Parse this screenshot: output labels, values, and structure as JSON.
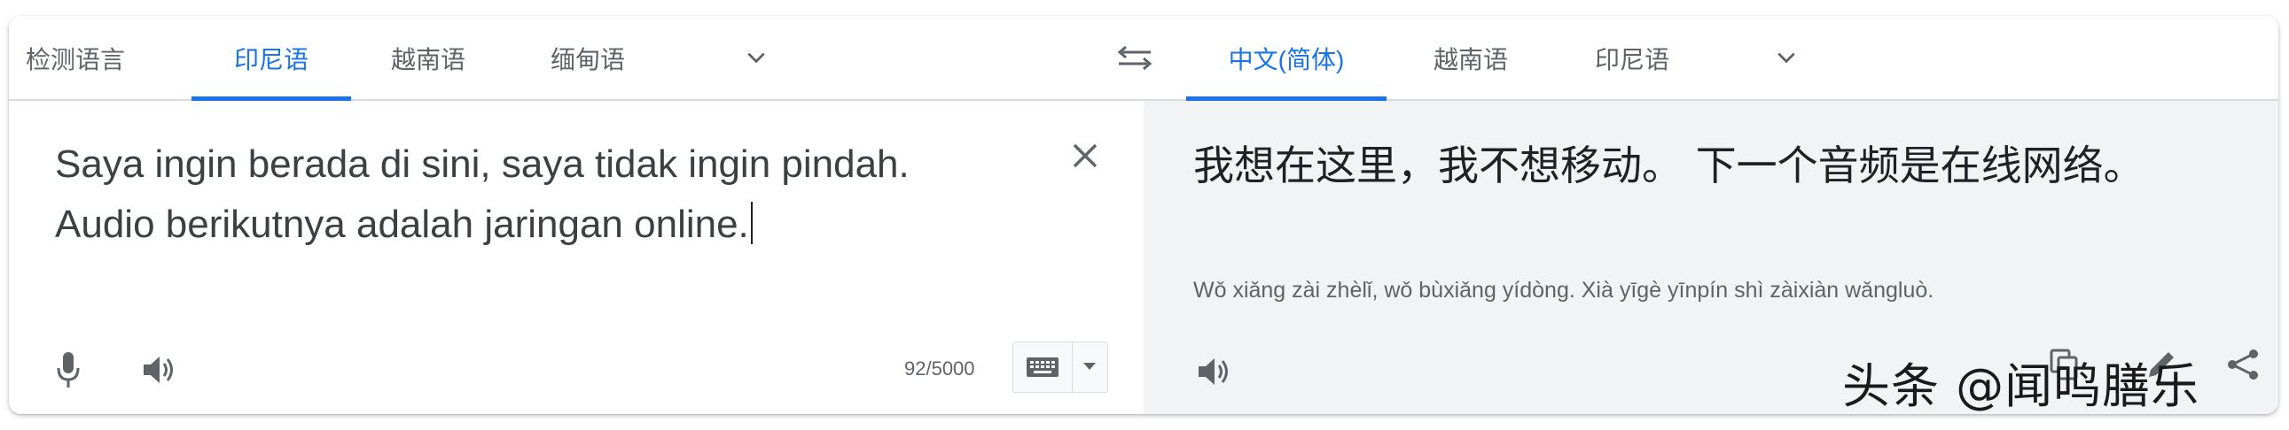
{
  "source_tabs": [
    {
      "label": "检测语言",
      "active": false
    },
    {
      "label": "印尼语",
      "active": true
    },
    {
      "label": "越南语",
      "active": false
    },
    {
      "label": "缅甸语",
      "active": false
    }
  ],
  "target_tabs": [
    {
      "label": "中文(简体)",
      "active": true
    },
    {
      "label": "越南语",
      "active": false
    },
    {
      "label": "印尼语",
      "active": false
    }
  ],
  "source": {
    "text": "Saya ingin berada di sini, saya tidak ingin pindah. Audio berikutnya adalah jaringan online.",
    "char_count": "92/5000"
  },
  "target": {
    "text": "我想在这里，我不想移动。 下一个音频是在线网络。",
    "transliteration": "Wǒ xiǎng zài zhèlǐ, wǒ bùxiǎng yídòng. Xià yīgè yīnpín shì zàixiàn wǎngluò."
  },
  "watermark": "头条 @闻鸣膳乐",
  "colors": {
    "accent": "#1a73e8",
    "target_bg": "#f1f3f4",
    "text": "#3c4043",
    "muted": "#5f6368"
  },
  "icons": [
    "chevron-down-icon",
    "swap-languages-icon",
    "clear-icon",
    "microphone-icon",
    "speaker-icon",
    "keyboard-icon",
    "copy-icon",
    "edit-icon",
    "share-icon"
  ]
}
